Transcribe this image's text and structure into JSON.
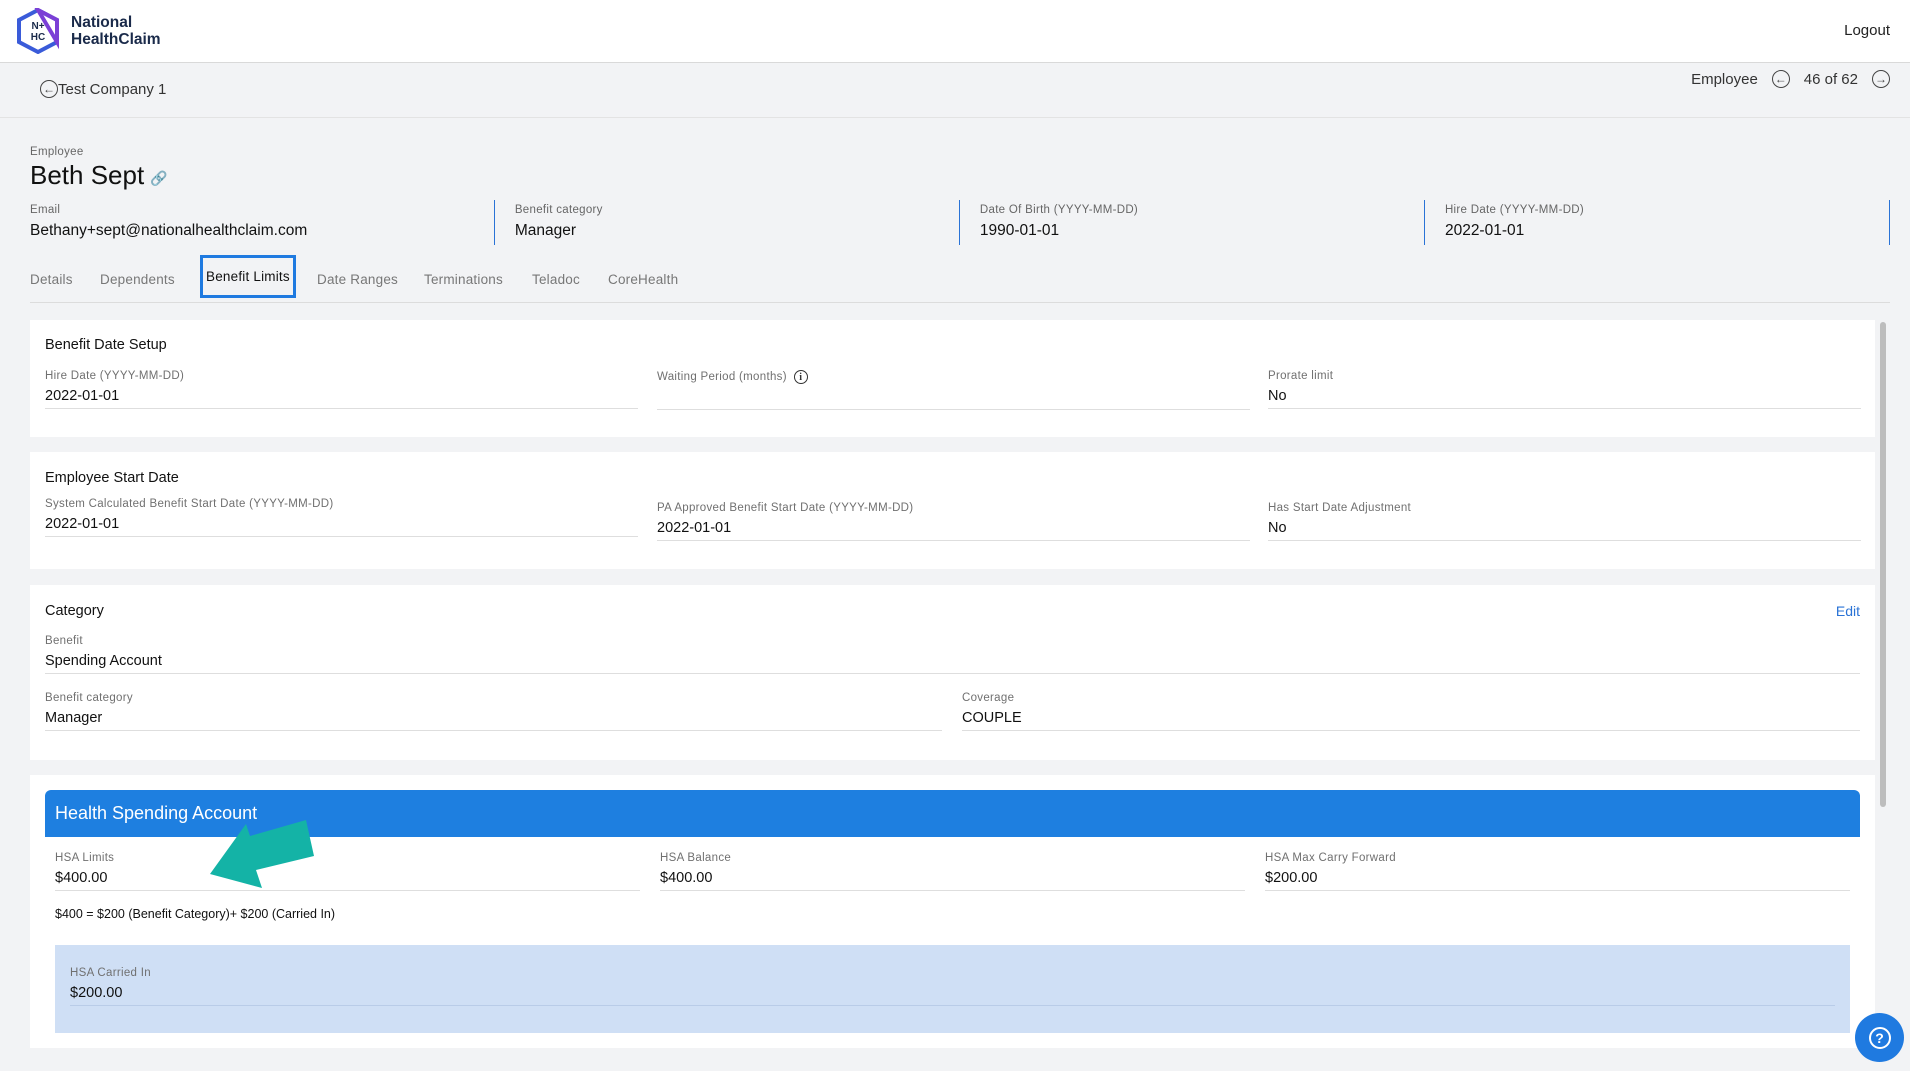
{
  "header": {
    "logo_line1": "National",
    "logo_line2": "HealthClaim",
    "logo_mark": "N+HC",
    "logout": "Logout"
  },
  "subheader": {
    "back_label": "Test Company 1",
    "pager_label": "Employee",
    "pager_position": "46 of 62"
  },
  "employee": {
    "label": "Employee",
    "name": "Beth Sept",
    "info": [
      {
        "label": "Email",
        "value": "Bethany+sept@nationalhealthclaim.com"
      },
      {
        "label": "Benefit category",
        "value": "Manager"
      },
      {
        "label": "Date Of Birth (YYYY-MM-DD)",
        "value": "1990-01-01"
      },
      {
        "label": "Hire Date (YYYY-MM-DD)",
        "value": "2022-01-01"
      }
    ]
  },
  "tabs": [
    "Details",
    "Dependents",
    "Benefit Limits",
    "Date Ranges",
    "Terminations",
    "Teladoc",
    "CoreHealth"
  ],
  "active_tab": "Benefit Limits",
  "benefit_date_setup": {
    "title": "Benefit Date Setup",
    "hire_date_label": "Hire Date (YYYY-MM-DD)",
    "hire_date_value": "2022-01-01",
    "waiting_label": "Waiting Period (months)",
    "waiting_value": "",
    "prorate_label": "Prorate limit",
    "prorate_value": "No"
  },
  "employee_start": {
    "title": "Employee Start Date",
    "system_label": "System Calculated Benefit Start Date (YYYY-MM-DD)",
    "system_value": "2022-01-01",
    "pa_label": "PA Approved Benefit Start Date (YYYY-MM-DD)",
    "pa_value": "2022-01-01",
    "adjust_label": "Has Start Date Adjustment",
    "adjust_value": "No"
  },
  "category": {
    "title": "Category",
    "edit": "Edit",
    "benefit_label": "Benefit",
    "benefit_value": "Spending Account",
    "bcat_label": "Benefit category",
    "bcat_value": "Manager",
    "coverage_label": "Coverage",
    "coverage_value": "COUPLE"
  },
  "hsa": {
    "title": "Health Spending Account",
    "limits_label": "HSA Limits",
    "limits_value": "$400.00",
    "balance_label": "HSA Balance",
    "balance_value": "$400.00",
    "carry_label": "HSA Max Carry Forward",
    "carry_value": "$200.00",
    "formula": "$400 = $200 (Benefit Category)+ $200 (Carried In)",
    "carried_label": "HSA Carried In",
    "carried_value": "$200.00"
  },
  "colors": {
    "accent": "#1e7fe0",
    "annotation_arrow": "#14b3a6",
    "carried_bg": "#cfdff5"
  }
}
